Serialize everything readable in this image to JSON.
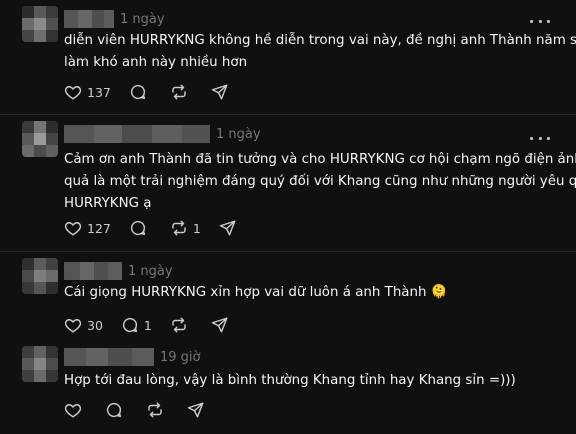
{
  "posts": [
    {
      "time": "1 ngày",
      "lines": [
        "diễn viên HURRYKNG không hề diễn trong vai này, đề nghị anh Thành năm sau",
        "làm khó anh này nhiều hơn"
      ],
      "likes": "137",
      "replies": "",
      "reposts": ""
    },
    {
      "time": "1 ngày",
      "lines": [
        "Cảm ơn anh Thành đã tin tưởng và cho HURRYKNG cơ hội chạm ngõ điện ảnh,",
        "quả là một trải nghiệm đáng quý đối với Khang cũng như những người yêu quý",
        "HURRYKNG ạ"
      ],
      "likes": "127",
      "replies": "",
      "reposts": "1"
    },
    {
      "time": "1 ngày",
      "lines": [
        "Cái giọng HURRYKNG xỉn hợp vai dữ luôn á anh Thành 🫠"
      ],
      "likes": "30",
      "replies": "1",
      "reposts": ""
    },
    {
      "time": "19 giờ",
      "lines": [
        "Hợp tới đau lòng, vậy là bình thường Khang tỉnh hay Khang sỉn =)))"
      ],
      "likes": "",
      "replies": "",
      "reposts": ""
    }
  ],
  "icons": {
    "like": "heart-icon",
    "reply": "comment-icon",
    "repost": "repost-icon",
    "share": "send-icon",
    "more": "more-icon"
  },
  "colors": {
    "background": "#101010",
    "text": "#f3f5f7",
    "muted": "#777777",
    "icon": "#cccccc",
    "divider": "#2a2a2a"
  }
}
